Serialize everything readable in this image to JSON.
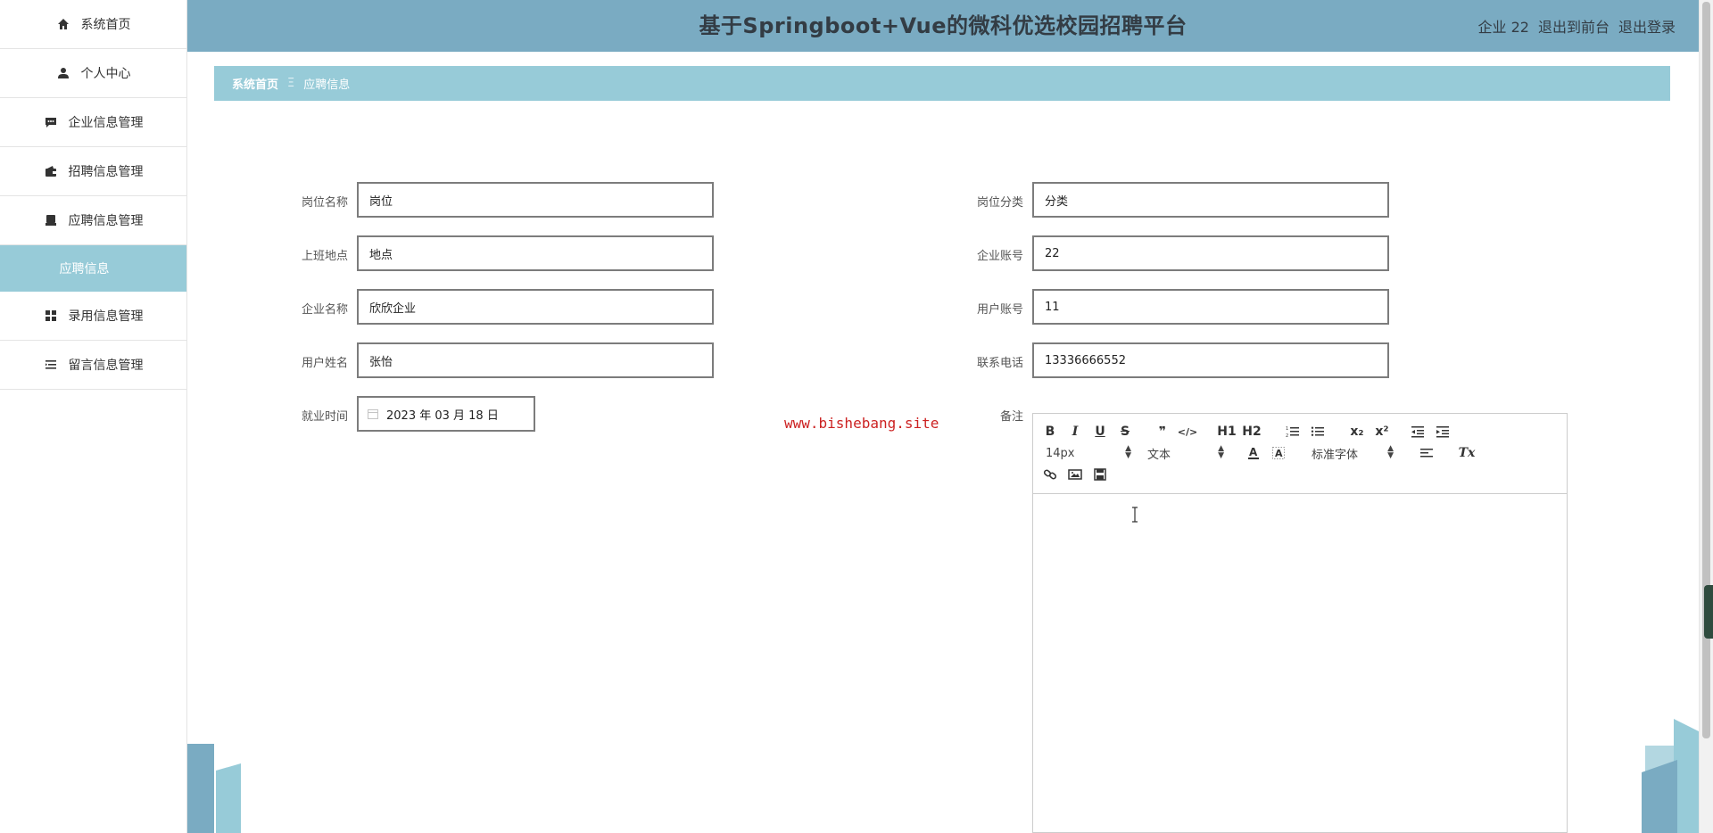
{
  "header": {
    "title": "基于Springboot+Vue的微科优选校园招聘平台",
    "user": "企业 22",
    "to_front": "退出到前台",
    "logout": "退出登录"
  },
  "sidebar": {
    "items": [
      {
        "label": "系统首页",
        "icon": "home-icon"
      },
      {
        "label": "个人中心",
        "icon": "user-icon"
      },
      {
        "label": "企业信息管理",
        "icon": "chat-icon"
      },
      {
        "label": "招聘信息管理",
        "icon": "wallet-icon"
      },
      {
        "label": "应聘信息管理",
        "icon": "monitor-icon"
      }
    ],
    "active_sub": "应聘信息",
    "items_after": [
      {
        "label": "录用信息管理",
        "icon": "grid-icon"
      },
      {
        "label": "留言信息管理",
        "icon": "list-icon"
      }
    ]
  },
  "breadcrumb": {
    "home": "系统首页",
    "separator": "Ξ",
    "current": "应聘信息"
  },
  "form": {
    "job_name": {
      "label": "岗位名称",
      "value": "岗位"
    },
    "job_category": {
      "label": "岗位分类",
      "value": "分类"
    },
    "work_location": {
      "label": "上班地点",
      "value": "地点"
    },
    "company_account": {
      "label": "企业账号",
      "value": "22"
    },
    "company_name": {
      "label": "企业名称",
      "value": "欣欣企业"
    },
    "user_account": {
      "label": "用户账号",
      "value": "11"
    },
    "user_name": {
      "label": "用户姓名",
      "value": "张怡"
    },
    "phone": {
      "label": "联系电话",
      "value": "13336666552"
    },
    "employ_time": {
      "label": "就业时间",
      "value": "2023 年 03 月 18 日"
    },
    "remark": {
      "label": "备注"
    }
  },
  "watermark": "www.bishebang.site",
  "editor": {
    "font_size": "14px",
    "text_style": "文本",
    "font_family": "标准字体",
    "buttons": {
      "bold": "B",
      "italic": "I",
      "underline": "U",
      "strike": "S",
      "quote": "❞",
      "code": "</>",
      "h1": "H1",
      "h2": "H2",
      "subscript": "x₂",
      "superscript": "x²",
      "clean": "Tx"
    }
  },
  "colors": {
    "topbar": "#7aabc2",
    "breadcrumb": "#97cbd8",
    "sidebar_active": "#97cbd8",
    "watermark": "#cc2222"
  }
}
